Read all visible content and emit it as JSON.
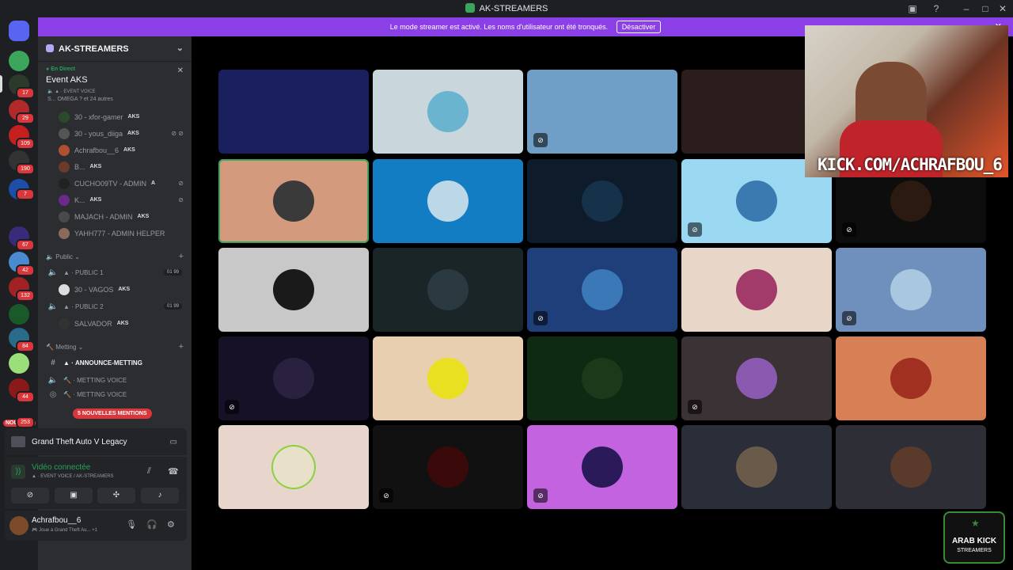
{
  "window": {
    "title": "AK-STREAMERS"
  },
  "banner": {
    "text": "Le mode streamer est activé. Les noms d'utilisateur ont été tronqués.",
    "button": "Désactiver"
  },
  "rail": {
    "badges": [
      "17",
      "29",
      "109",
      "190",
      "7",
      "67",
      "42",
      "132",
      "84",
      "44",
      "253"
    ],
    "new_label": "NOUVEAU"
  },
  "server": {
    "name": "AK-STREAMERS"
  },
  "live": {
    "tag": "En Direct",
    "event": "Event AKS",
    "channel": "EVENT VOICE",
    "participants": "S... OMEGA ? et 24 autres"
  },
  "voice_users": [
    {
      "name": "30 - xfor-gamer",
      "tag": "AKS"
    },
    {
      "name": "30 - yous_diiga",
      "tag": "AKS"
    },
    {
      "name": "Achrafbou__6",
      "tag": "AKS"
    },
    {
      "name": "B...",
      "tag": "AKS"
    },
    {
      "name": "CUCHO09TV - ADMIN",
      "tag": "A"
    },
    {
      "name": "K...",
      "tag": "AKS"
    },
    {
      "name": "MAJACH - ADMIN",
      "tag": "AKS"
    },
    {
      "name": "YAHH777 - ADMIN HELPER",
      "tag": ""
    }
  ],
  "categories": {
    "public": "Public",
    "meeting": "Metting"
  },
  "channels": {
    "public1": {
      "name": "PUBLIC 1",
      "count": "01 99"
    },
    "public1_user": {
      "name": "30 - VAGOS",
      "tag": "AKS"
    },
    "public2": {
      "name": "PUBLIC 2",
      "count": "01 99"
    },
    "public2_user": {
      "name": "SALVADOR",
      "tag": "AKS"
    },
    "announce": "ANNOUNCE-METTING",
    "meeting_voice": "METTING VOICE",
    "meeting_voice2": "METTING VOICE"
  },
  "mentions": "5 NOUVELLES MENTIONS",
  "game": {
    "name": "Grand Theft Auto V Legacy"
  },
  "voice": {
    "status": "Vidéo connectée",
    "location": "EVENT VOICE / AK-STREAMERS"
  },
  "user": {
    "name": "Achrafbou__6",
    "status": "Joue à Grand Theft Au...",
    "extra": "+1"
  },
  "webcam": {
    "overlay_text": "KICK.COM/ACHRAFBOU_6"
  },
  "logo": {
    "title": "ARAB KICK",
    "subtitle": "STREAMERS"
  },
  "tile_colors": [
    "#1a1f5e",
    "#c9d6dc",
    "#6f9fc6",
    "#2a1d1b",
    "",
    "#d49a7e",
    "#127dc2",
    "#0e1b2a",
    "#9ad8f2",
    "#0d0d0d",
    "#c8c8c8",
    "#1a2528",
    "#1e3f7a",
    "#e8d6c8",
    "#6f8fbd",
    "#171128",
    "#e8cfb0",
    "#0f2a12",
    "#3a3234",
    "#d88055",
    "#e8d6cc",
    "#111111",
    "#c463e0",
    "#2a2e38",
    "#2e2e36"
  ],
  "accent": "#8b3fe6",
  "online_green": "#23a559"
}
